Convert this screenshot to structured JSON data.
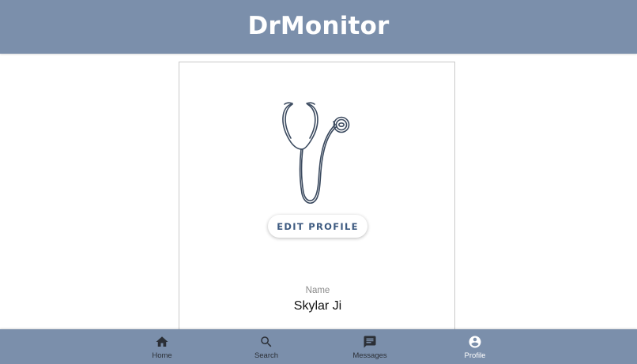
{
  "header": {
    "title": "DrMonitor"
  },
  "profile": {
    "image_icon": "stethoscope-icon",
    "edit_button_label": "EDIT PROFILE",
    "name_label": "Name",
    "name_value": "Skylar Ji"
  },
  "bottom_nav": {
    "items": [
      {
        "label": "Home",
        "icon": "home-icon"
      },
      {
        "label": "Search",
        "icon": "search-icon"
      },
      {
        "label": "Messages",
        "icon": "message-icon"
      },
      {
        "label": "Profile",
        "icon": "account-circle-icon",
        "active": true
      }
    ]
  },
  "colors": {
    "header_bg": "#7b8fab",
    "nav_bg": "#7b8fab",
    "button_text": "#3d5a80",
    "icon_dark": "#2b2f36",
    "active_nav": "#ffffff"
  }
}
